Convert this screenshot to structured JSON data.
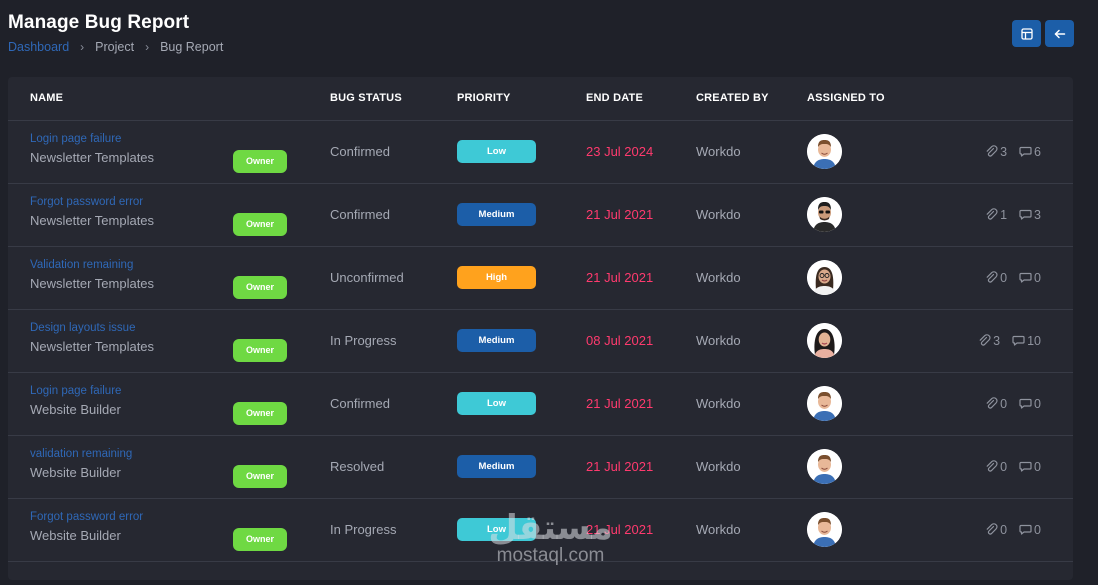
{
  "header": {
    "title": "Manage Bug Report",
    "breadcrumb": [
      "Dashboard",
      "Project",
      "Bug Report"
    ],
    "breadcrumb_separator": "›",
    "actions": [
      {
        "icon": "grid-view-icon"
      },
      {
        "icon": "arrow-left-icon"
      }
    ]
  },
  "table": {
    "columns": [
      "NAME",
      "BUG STATUS",
      "PRIORITY",
      "END DATE",
      "CREATED BY",
      "ASSIGNED TO"
    ],
    "rows": [
      {
        "title": "Login page failure",
        "project": "Newsletter Templates",
        "role": "Owner",
        "status": "Confirmed",
        "priority": "Low",
        "end_date": "23 Jul 2024",
        "created_by": "Workdo",
        "avatar": "avatar-man-smiling",
        "attachments": "3",
        "comments": "6"
      },
      {
        "title": "Forgot password error",
        "project": "Newsletter Templates",
        "role": "Owner",
        "status": "Confirmed",
        "priority": "Medium",
        "end_date": "21 Jul 2021",
        "created_by": "Workdo",
        "avatar": "avatar-man-sunglasses",
        "attachments": "1",
        "comments": "3"
      },
      {
        "title": "Validation remaining",
        "project": "Newsletter Templates",
        "role": "Owner",
        "status": "Unconfirmed",
        "priority": "High",
        "end_date": "21 Jul 2021",
        "created_by": "Workdo",
        "avatar": "avatar-woman-glasses",
        "attachments": "0",
        "comments": "0"
      },
      {
        "title": "Design layouts issue",
        "project": "Newsletter Templates",
        "role": "Owner",
        "status": "In Progress",
        "priority": "Medium",
        "end_date": "08 Jul 2021",
        "created_by": "Workdo",
        "avatar": "avatar-woman-dark-hair",
        "attachments": "3",
        "comments": "10"
      },
      {
        "title": "Login page failure",
        "project": "Website Builder",
        "role": "Owner",
        "status": "Confirmed",
        "priority": "Low",
        "end_date": "21 Jul 2021",
        "created_by": "Workdo",
        "avatar": "avatar-man-smiling",
        "attachments": "0",
        "comments": "0"
      },
      {
        "title": "validation remaining",
        "project": "Website Builder",
        "role": "Owner",
        "status": "Resolved",
        "priority": "Medium",
        "end_date": "21 Jul 2021",
        "created_by": "Workdo",
        "avatar": "avatar-man-smiling",
        "attachments": "0",
        "comments": "0"
      },
      {
        "title": "Forgot password error",
        "project": "Website Builder",
        "role": "Owner",
        "status": "In Progress",
        "priority": "Low",
        "end_date": "21 Jul 2021",
        "created_by": "Workdo",
        "avatar": "avatar-man-smiling",
        "attachments": "0",
        "comments": "0"
      }
    ]
  },
  "colors": {
    "background": "#1f2129",
    "card": "#262831",
    "primary": "#1c5ea8",
    "link": "#2f68b7",
    "owner": "#6fd943",
    "priority_low": "#3ec9d6",
    "priority_medium": "#1c5ea8",
    "priority_high": "#ffa21d",
    "date": "#ff3a6e"
  },
  "watermark": {
    "logo": "مستقل",
    "text": "mostaql.com"
  }
}
